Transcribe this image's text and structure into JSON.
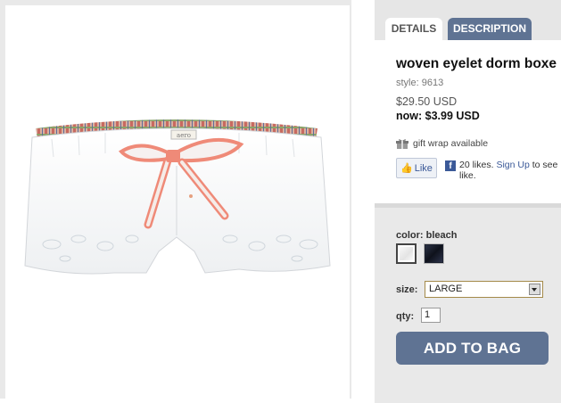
{
  "tabs": [
    {
      "label": "DETAILS",
      "active": true
    },
    {
      "label": "DESCRIPTION",
      "active": false
    }
  ],
  "product": {
    "title": "woven eyelet dorm boxe",
    "style": "style: 9613",
    "price_original": "$29.50 USD",
    "price_now": "now: $3.99 USD",
    "image_alt": "aero"
  },
  "gift_wrap": {
    "text": "gift wrap available",
    "icon": "gift-icon"
  },
  "facebook": {
    "like_label": "Like",
    "likes_text": "20 likes.",
    "signup_label": "Sign Up",
    "signup_suffix": "to see like."
  },
  "options": {
    "color_label": "color: bleach",
    "swatches": [
      "bleach",
      "navy"
    ],
    "size_label": "size:",
    "size_value": "LARGE",
    "qty_label": "qty:",
    "qty_value": "1"
  },
  "add_to_bag_label": "ADD TO BAG",
  "colors": {
    "tab_inactive": "#5f7393",
    "button": "#5f7393",
    "panel_bg": "#e9e9e9",
    "facebook_blue": "#3b5998"
  }
}
